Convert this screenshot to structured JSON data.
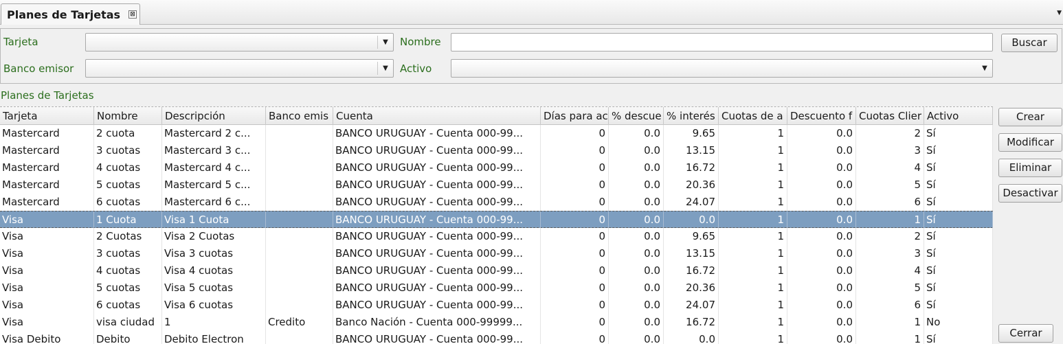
{
  "tab": {
    "title": "Planes de Tarjetas",
    "close_glyph": "⊠",
    "menu_glyph": "▼"
  },
  "filters": {
    "tarjeta_label": "Tarjeta",
    "tarjeta_value": "",
    "nombre_label": "Nombre",
    "nombre_value": "",
    "banco_label": "Banco emisor",
    "banco_value": "",
    "activo_label": "Activo",
    "activo_value": "",
    "buscar_label": "Buscar",
    "arrow_glyph": "▼"
  },
  "section_title": "Planes de Tarjetas",
  "table": {
    "columns": [
      "Tarjeta",
      "Nombre",
      "Descripción",
      "Banco emis",
      "Cuenta",
      "Días para ac",
      "% descue",
      "% interés",
      "Cuotas de a",
      "Descuento f",
      "Cuotas Clier",
      "Activo"
    ],
    "rows": [
      [
        "Mastercard",
        "2 cuota",
        "Mastercard 2 c...",
        "",
        "BANCO URUGUAY - Cuenta 000-99...",
        "0",
        "0.0",
        "9.65",
        "1",
        "0.0",
        "2",
        "Sí"
      ],
      [
        "Mastercard",
        "3 cuotas",
        "Mastercard 3 c...",
        "",
        "BANCO URUGUAY - Cuenta 000-99...",
        "0",
        "0.0",
        "13.15",
        "1",
        "0.0",
        "3",
        "Sí"
      ],
      [
        "Mastercard",
        "4 cuotas",
        "Mastercard 4 c...",
        "",
        "BANCO URUGUAY - Cuenta 000-99...",
        "0",
        "0.0",
        "16.72",
        "1",
        "0.0",
        "4",
        "Sí"
      ],
      [
        "Mastercard",
        "5 cuotas",
        "Mastercard 5 c...",
        "",
        "BANCO URUGUAY - Cuenta 000-99...",
        "0",
        "0.0",
        "20.36",
        "1",
        "0.0",
        "5",
        "Sí"
      ],
      [
        "Mastercard",
        "6 cuotas",
        "Mastercard 6 c...",
        "",
        "BANCO URUGUAY - Cuenta 000-99...",
        "0",
        "0.0",
        "24.07",
        "1",
        "0.0",
        "6",
        "Sí"
      ],
      [
        "Visa",
        "1 Cuota",
        "Visa 1 Cuota",
        "",
        "BANCO URUGUAY - Cuenta 000-99...",
        "0",
        "0.0",
        "0.0",
        "1",
        "0.0",
        "1",
        "Sí"
      ],
      [
        "Visa",
        "2 Cuotas",
        "Visa 2 Cuotas",
        "",
        "BANCO URUGUAY - Cuenta 000-99...",
        "0",
        "0.0",
        "9.65",
        "1",
        "0.0",
        "2",
        "Sí"
      ],
      [
        "Visa",
        "3 cuotas",
        "Visa 3 cuotas",
        "",
        "BANCO URUGUAY - Cuenta 000-99...",
        "0",
        "0.0",
        "13.15",
        "1",
        "0.0",
        "3",
        "Sí"
      ],
      [
        "Visa",
        "4 cuotas",
        "Visa 4 cuotas",
        "",
        "BANCO URUGUAY - Cuenta 000-99...",
        "0",
        "0.0",
        "16.72",
        "1",
        "0.0",
        "4",
        "Sí"
      ],
      [
        "Visa",
        "5 cuotas",
        "Visa 5 cuotas",
        "",
        "BANCO URUGUAY - Cuenta 000-99...",
        "0",
        "0.0",
        "20.36",
        "1",
        "0.0",
        "5",
        "Sí"
      ],
      [
        "Visa",
        "6 cuotas",
        "Visa 6 cuotas",
        "",
        "BANCO URUGUAY - Cuenta 000-99...",
        "0",
        "0.0",
        "24.07",
        "1",
        "0.0",
        "6",
        "Sí"
      ],
      [
        "Visa",
        "visa ciudad",
        "1",
        "Credito",
        "Banco Nación - Cuenta 000-99999...",
        "0",
        "0.0",
        "16.72",
        "1",
        "0.0",
        "1",
        "No"
      ],
      [
        "Visa Debito",
        "Debito",
        "Debito Electron",
        "",
        "BANCO URUGUAY - Cuenta 000-99...",
        "0",
        "0.0",
        "0.0",
        "1",
        "0.0",
        "1",
        "Sí"
      ]
    ],
    "selected_row": 5
  },
  "actions": {
    "crear": "Crear",
    "modificar": "Modificar",
    "eliminar": "Eliminar",
    "desactivar": "Desactivar",
    "cerrar": "Cerrar"
  },
  "colors": {
    "label_green": "#2b6e1d",
    "selection": "#7d9ec0"
  }
}
